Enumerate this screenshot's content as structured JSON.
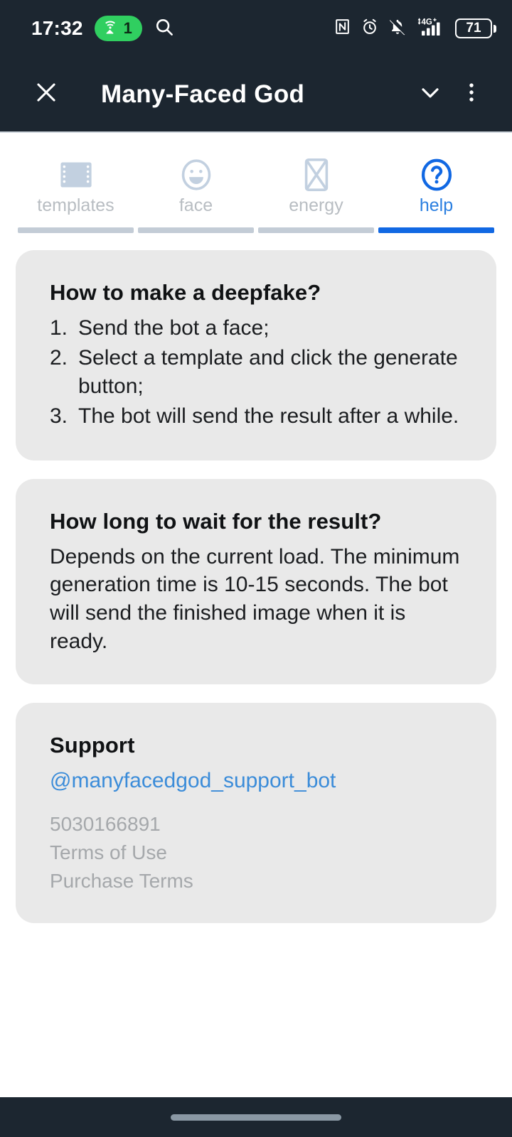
{
  "status_bar": {
    "time": "17:32",
    "hotspot_count": "1",
    "battery_percent": "71",
    "icons": {
      "hotspot": "wifi-tethering-icon",
      "search": "search-icon",
      "nfc": "nfc-icon",
      "alarm": "alarm-icon",
      "mute": "bell-muted-icon",
      "network": "signal-4g-plus-icon",
      "battery": "battery-icon"
    },
    "network_label": "4G"
  },
  "app_bar": {
    "title": "Many-Faced God",
    "close_icon": "close-icon",
    "collapse_icon": "chevron-down-icon",
    "menu_icon": "more-vertical-icon"
  },
  "tabs": [
    {
      "label": "templates",
      "icon": "film-strip-icon",
      "active": false
    },
    {
      "label": "face",
      "icon": "smiley-face-icon",
      "active": false
    },
    {
      "label": "energy",
      "icon": "broken-image-placeholder-icon",
      "active": false
    },
    {
      "label": "help",
      "icon": "question-mark-circle-icon",
      "active": true
    }
  ],
  "cards": {
    "how_to": {
      "title": "How to make a deepfake?",
      "steps": [
        {
          "num": "1.",
          "text": "Send the bot a face;"
        },
        {
          "num": "2.",
          "text": "Select a template and click the generate button;"
        },
        {
          "num": "3.",
          "text": "The bot will send the result after a while."
        }
      ]
    },
    "how_long": {
      "title": "How long to wait for the result?",
      "body": "Depends on the current load. The minimum generation time is 10-15 seconds. The bot will send the finished image when it is ready."
    },
    "support": {
      "title": "Support",
      "handle": "@manyfacedgod_support_bot",
      "user_id": "5030166891",
      "terms_of_use": "Terms of Use",
      "purchase_terms": "Purchase Terms"
    }
  },
  "colors": {
    "header_bg": "#1c2630",
    "card_bg": "#e9e9e9",
    "accent_blue": "#1168e3",
    "link_blue": "#3b8cd9",
    "tab_inactive": "#b8bdc2",
    "hotspot_green": "#30cf60"
  },
  "nav_bar": {
    "gesture_pill": "home-gesture-pill"
  }
}
